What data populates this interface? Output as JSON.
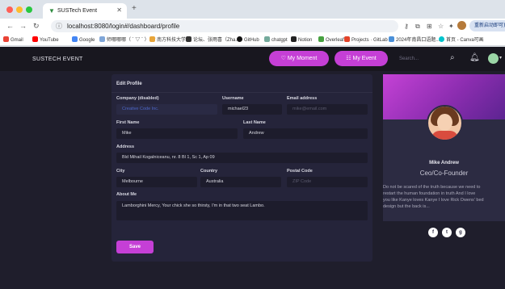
{
  "browser": {
    "tab_title": "SUSTech Event",
    "url": "localhost:8080/login#/dashboard/profile",
    "restart_label": "重新启动即可更新",
    "bookmarks": [
      {
        "label": "Gmail",
        "color": "#ea4335"
      },
      {
        "label": "YouTube",
        "color": "#ff0000"
      },
      {
        "label": "Google",
        "color": "#4285f4"
      },
      {
        "label": "师哪哪哪（ ´ ▽ ` ）ﾉゞ",
        "color": "#7fa6d8"
      },
      {
        "label": "南方科技大学",
        "color": "#e8a53a"
      },
      {
        "label": "论坛、张雨喜（Zha...",
        "color": "#333333"
      },
      {
        "label": "GitHub",
        "color": "#111111"
      },
      {
        "label": "chatgpt",
        "color": "#74aa9c"
      },
      {
        "label": "Notion",
        "color": "#222222"
      },
      {
        "label": "Overleaf",
        "color": "#47a141"
      },
      {
        "label": "Projects · GitLab",
        "color": "#e24329"
      },
      {
        "label": "2024年南昌口语题...",
        "color": "#4a90d9"
      },
      {
        "label": "首页 - Canva可画",
        "color": "#00c4cc"
      }
    ]
  },
  "app": {
    "brand": "SUSTECH EVENT",
    "nav": {
      "my_moment": "♡ My Moment",
      "my_event": "☷ My Event",
      "search_placeholder": "Search..."
    }
  },
  "form": {
    "title": "Edit Profile",
    "company_label": "Company (disabled)",
    "company_value": "Creative Code Inc.",
    "username_label": "Username",
    "username_value": "michael23",
    "email_label": "Email address",
    "email_placeholder": "mike@email.com",
    "first_name_label": "First Name",
    "first_name_value": "Mike",
    "last_name_label": "Last Name",
    "last_name_value": "Andrew",
    "address_label": "Address",
    "address_value": "Bld Mihail Kogalniceanu, nr. 8 Bl 1, Sc 1, Ap 09",
    "city_label": "City",
    "city_value": "Melbourne",
    "country_label": "Country",
    "country_value": "Australia",
    "postal_label": "Postal Code",
    "postal_placeholder": "ZIP Code",
    "about_label": "About Me",
    "about_value": "Lamborghini Mercy, Your chick she so thirsty, I'm in that two seat Lambo.",
    "save_label": "Save"
  },
  "profile_card": {
    "name": "Mike Andrew",
    "role": "Ceo/Co-Founder",
    "quote_lines": [
      "Do not be scared of the truth because we need to",
      "restart the human foundation in truth And I love",
      "you like Kanye loves Kanye I love Rick Owens' bed",
      "design but the back is..."
    ],
    "socials": [
      "f",
      "t",
      "g"
    ]
  },
  "colors": {
    "accent": "#c53fd6",
    "page_bg": "#1f1e2c",
    "card_bg": "#25243a"
  }
}
